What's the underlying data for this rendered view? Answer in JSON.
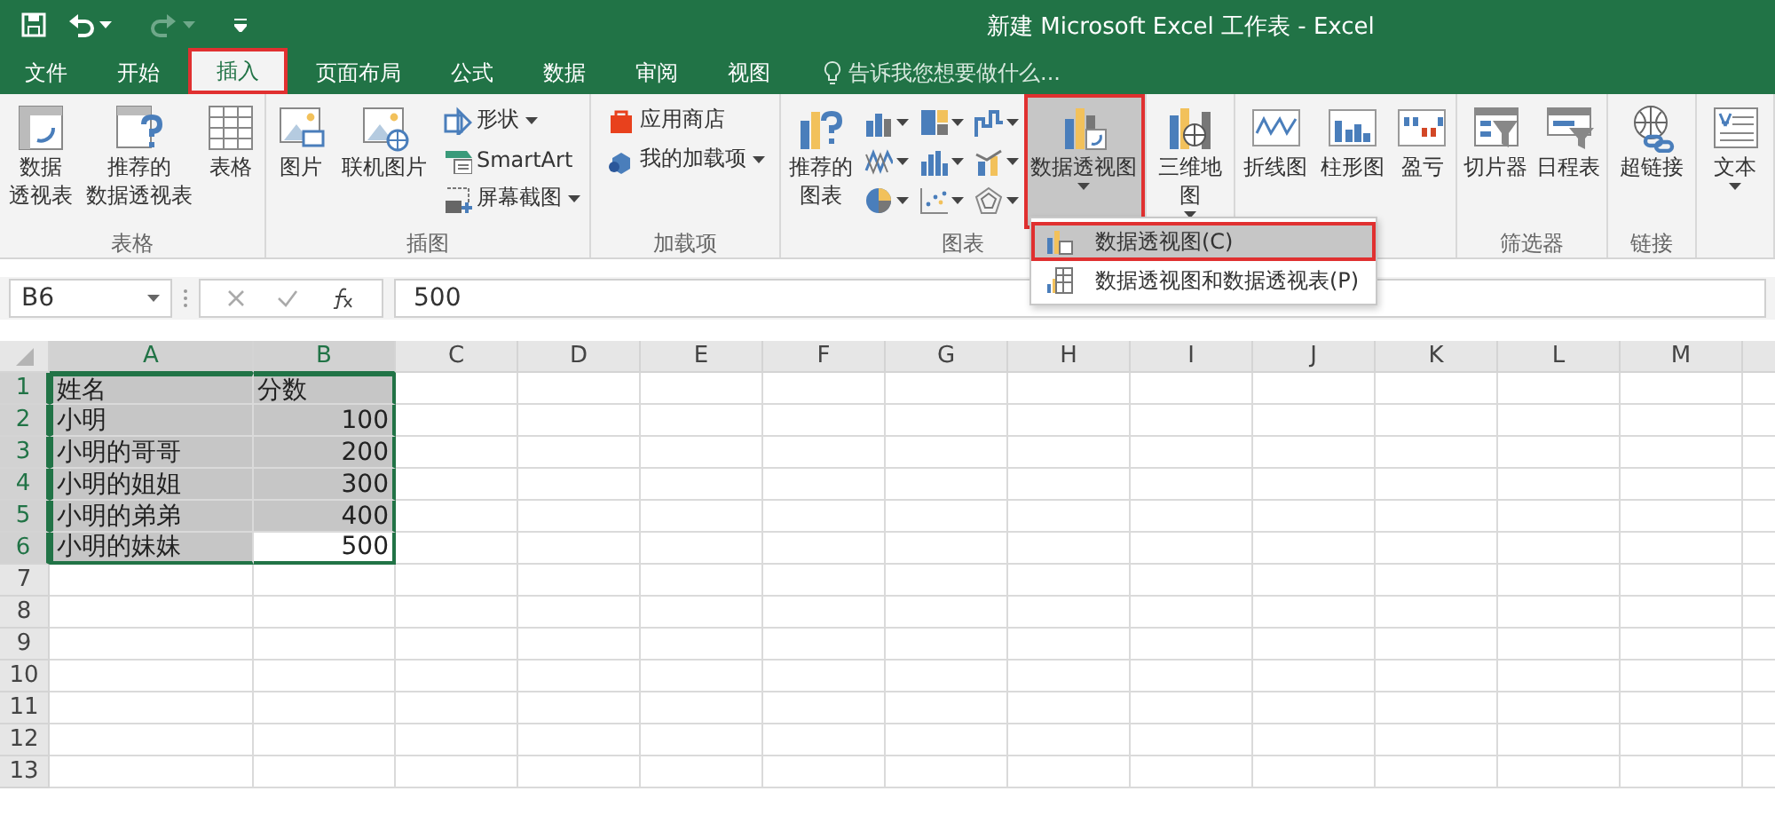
{
  "window": {
    "title": "新建 Microsoft Excel 工作表 - Excel"
  },
  "tabs": [
    {
      "label": "文件",
      "selected": false,
      "highlighted": false
    },
    {
      "label": "开始",
      "selected": false,
      "highlighted": false
    },
    {
      "label": "插入",
      "selected": true,
      "highlighted": true
    },
    {
      "label": "页面布局",
      "selected": false,
      "highlighted": false
    },
    {
      "label": "公式",
      "selected": false,
      "highlighted": false
    },
    {
      "label": "数据",
      "selected": false,
      "highlighted": false
    },
    {
      "label": "审阅",
      "selected": false,
      "highlighted": false
    },
    {
      "label": "视图",
      "selected": false,
      "highlighted": false
    }
  ],
  "tell_me": {
    "placeholder": "告诉我您想要做什么..."
  },
  "ribbon": {
    "groups": [
      {
        "label": "表格",
        "items": [
          {
            "kind": "large",
            "lines": [
              "数据",
              "透视表"
            ],
            "dropdown": false,
            "pressed": false,
            "highlighted": false
          },
          {
            "kind": "large",
            "lines": [
              "推荐的",
              "数据透视表"
            ],
            "dropdown": false,
            "pressed": false,
            "highlighted": false
          },
          {
            "kind": "large",
            "lines": [
              "表格"
            ],
            "dropdown": false,
            "pressed": false,
            "highlighted": false
          }
        ]
      },
      {
        "label": "插图",
        "items": [
          {
            "kind": "large",
            "lines": [
              "图片"
            ],
            "dropdown": false,
            "pressed": false,
            "highlighted": false
          },
          {
            "kind": "large",
            "lines": [
              "联机图片"
            ],
            "dropdown": false,
            "pressed": false,
            "highlighted": false
          },
          {
            "kind": "small",
            "label": "形状",
            "dropdown": true
          },
          {
            "kind": "small",
            "label": "SmartArt",
            "dropdown": false
          },
          {
            "kind": "small",
            "label": "屏幕截图",
            "dropdown": true
          }
        ]
      },
      {
        "label": "加载项",
        "items": [
          {
            "kind": "small",
            "label": "应用商店",
            "dropdown": false
          },
          {
            "kind": "small",
            "label": "我的加载项",
            "dropdown": true
          }
        ]
      },
      {
        "label": "图表",
        "items": [
          {
            "kind": "large",
            "lines": [
              "推荐的",
              "图表"
            ],
            "dropdown": false,
            "pressed": false,
            "highlighted": false
          },
          {
            "kind": "icon",
            "dropdown": true
          },
          {
            "kind": "icon",
            "dropdown": true
          },
          {
            "kind": "icon",
            "dropdown": true
          },
          {
            "kind": "icon",
            "dropdown": true
          },
          {
            "kind": "icon",
            "dropdown": true
          },
          {
            "kind": "icon",
            "dropdown": true
          },
          {
            "kind": "icon",
            "dropdown": true
          },
          {
            "kind": "icon",
            "dropdown": true
          },
          {
            "kind": "icon",
            "dropdown": true
          },
          {
            "kind": "large",
            "lines": [
              "数据透视图"
            ],
            "dropdown": true,
            "pressed": true,
            "highlighted": true
          }
        ]
      },
      {
        "items": [
          {
            "kind": "large",
            "lines": [
              "三维地",
              "图"
            ],
            "dropdown": true,
            "pressed": false,
            "highlighted": false
          }
        ]
      },
      {
        "items": [
          {
            "kind": "large",
            "lines": [
              "折线图"
            ],
            "dropdown": false,
            "pressed": false,
            "highlighted": false
          },
          {
            "kind": "large",
            "lines": [
              "柱形图"
            ],
            "dropdown": false,
            "pressed": false,
            "highlighted": false
          },
          {
            "kind": "large",
            "lines": [
              "盈亏"
            ],
            "dropdown": false,
            "pressed": false,
            "highlighted": false
          }
        ]
      },
      {
        "label": "筛选器",
        "items": [
          {
            "kind": "large",
            "lines": [
              "切片器"
            ],
            "dropdown": false,
            "pressed": false,
            "highlighted": false
          },
          {
            "kind": "large",
            "lines": [
              "日程表"
            ],
            "dropdown": false,
            "pressed": false,
            "highlighted": false
          }
        ]
      },
      {
        "label": "链接",
        "items": [
          {
            "kind": "large",
            "lines": [
              "超链接"
            ],
            "dropdown": false,
            "pressed": false,
            "highlighted": false
          }
        ]
      },
      {
        "items": [
          {
            "kind": "large",
            "lines": [
              "文本"
            ],
            "dropdown": true,
            "pressed": false,
            "highlighted": false
          }
        ]
      }
    ]
  },
  "menu": {
    "items": [
      {
        "label": "数据透视图(C)",
        "selected": true,
        "highlighted": true
      },
      {
        "label": "数据透视图和数据透视表(P)",
        "selected": false,
        "highlighted": false
      }
    ]
  },
  "formula_bar": {
    "name_box": "B6",
    "formula": "500"
  },
  "sheet": {
    "columns": [
      {
        "label": "A",
        "selected": true
      },
      {
        "label": "B",
        "selected": true
      },
      {
        "label": "C",
        "selected": false
      },
      {
        "label": "D",
        "selected": false
      },
      {
        "label": "E",
        "selected": false
      },
      {
        "label": "F",
        "selected": false
      },
      {
        "label": "G",
        "selected": false
      },
      {
        "label": "H",
        "selected": false
      },
      {
        "label": "I",
        "selected": false
      },
      {
        "label": "J",
        "selected": false
      },
      {
        "label": "K",
        "selected": false
      },
      {
        "label": "L",
        "selected": false
      },
      {
        "label": "M",
        "selected": false
      }
    ],
    "rows": [
      {
        "label": "1",
        "selected": true,
        "cells": [
          {
            "text": "姓名",
            "kind": "text",
            "active": false
          },
          {
            "text": "分数",
            "kind": "text",
            "active": false
          }
        ]
      },
      {
        "label": "2",
        "selected": true,
        "cells": [
          {
            "text": "小明",
            "kind": "text",
            "active": false
          },
          {
            "text": "100",
            "kind": "number",
            "active": false
          }
        ]
      },
      {
        "label": "3",
        "selected": true,
        "cells": [
          {
            "text": "小明的哥哥",
            "kind": "text",
            "active": false
          },
          {
            "text": "200",
            "kind": "number",
            "active": false
          }
        ]
      },
      {
        "label": "4",
        "selected": true,
        "cells": [
          {
            "text": "小明的姐姐",
            "kind": "text",
            "active": false
          },
          {
            "text": "300",
            "kind": "number",
            "active": false
          }
        ]
      },
      {
        "label": "5",
        "selected": true,
        "cells": [
          {
            "text": "小明的弟弟",
            "kind": "text",
            "active": false
          },
          {
            "text": "400",
            "kind": "number",
            "active": false
          }
        ]
      },
      {
        "label": "6",
        "selected": true,
        "cells": [
          {
            "text": "小明的妹妹",
            "kind": "text",
            "active": false
          },
          {
            "text": "500",
            "kind": "number",
            "active": true
          }
        ]
      },
      {
        "label": "7",
        "selected": false,
        "cells": []
      },
      {
        "label": "8",
        "selected": false,
        "cells": []
      },
      {
        "label": "9",
        "selected": false,
        "cells": []
      },
      {
        "label": "10",
        "selected": false,
        "cells": []
      },
      {
        "label": "11",
        "selected": false,
        "cells": []
      },
      {
        "label": "12",
        "selected": false,
        "cells": []
      },
      {
        "label": "13",
        "selected": false,
        "cells": []
      }
    ]
  }
}
